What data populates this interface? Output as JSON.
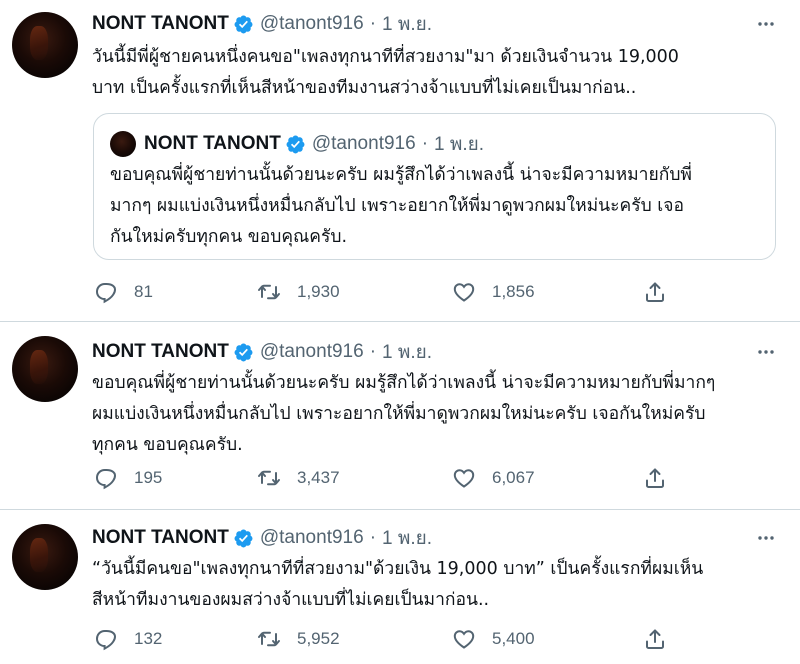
{
  "colors": {
    "text": "#0f1419",
    "secondary": "#536471",
    "verified": "#1d9bf0",
    "border": "#cfd9de"
  },
  "tweets": [
    {
      "name": "NONT TANONT",
      "handle": "@tanont916",
      "separator": "·",
      "date": "1 พ.ย.",
      "text": "วันนี้มีพี่ผู้ชายคนหนึ่งคนขอ\"เพลงทุกนาทีที่สวยงาม\"มา ด้วยเงินจำนวน 19,000\nบาท เป็นครั้งแรกที่เห็นสีหน้าของทีมงานสว่างจ้าแบบที่ไม่เคยเป็นมาก่อน..",
      "quote": {
        "name": "NONT TANONT",
        "handle": "@tanont916",
        "separator": "·",
        "date": "1 พ.ย.",
        "text": "ขอบคุณพี่ผู้ชายท่านนั้นด้วยนะครับ ผมรู้สึกได้ว่าเพลงนี้ น่าจะมีความหมายกับพี่\nมากๆ ผมแบ่งเงินหนึ่งหมื่นกลับไป เพราะอยากให้พี่มาดูพวกผมใหม่นะครับ เจอ\nกันใหม่ครับทุกคน ขอบคุณครับ."
      },
      "replies": "81",
      "retweets": "1,930",
      "likes": "1,856"
    },
    {
      "name": "NONT TANONT",
      "handle": "@tanont916",
      "separator": "·",
      "date": "1 พ.ย.",
      "text": "ขอบคุณพี่ผู้ชายท่านนั้นด้วยนะครับ ผมรู้สึกได้ว่าเพลงนี้ น่าจะมีความหมายกับพี่มากๆ\nผมแบ่งเงินหนึ่งหมื่นกลับไป เพราะอยากให้พี่มาดูพวกผมใหม่นะครับ เจอกันใหม่ครับ\nทุกคน ขอบคุณครับ.",
      "replies": "195",
      "retweets": "3,437",
      "likes": "6,067"
    },
    {
      "name": "NONT TANONT",
      "handle": "@tanont916",
      "separator": "·",
      "date": "1 พ.ย.",
      "text": "“วันนี้มีคนขอ\"เพลงทุกนาทีที่สวยงาม\"ด้วยเงิน 19,000 บาท” เป็นครั้งแรกที่ผมเห็น\nสีหน้าทีมงานของผมสว่างจ้าแบบที่ไม่เคยเป็นมาก่อน..",
      "replies": "132",
      "retweets": "5,952",
      "likes": "5,400"
    }
  ]
}
